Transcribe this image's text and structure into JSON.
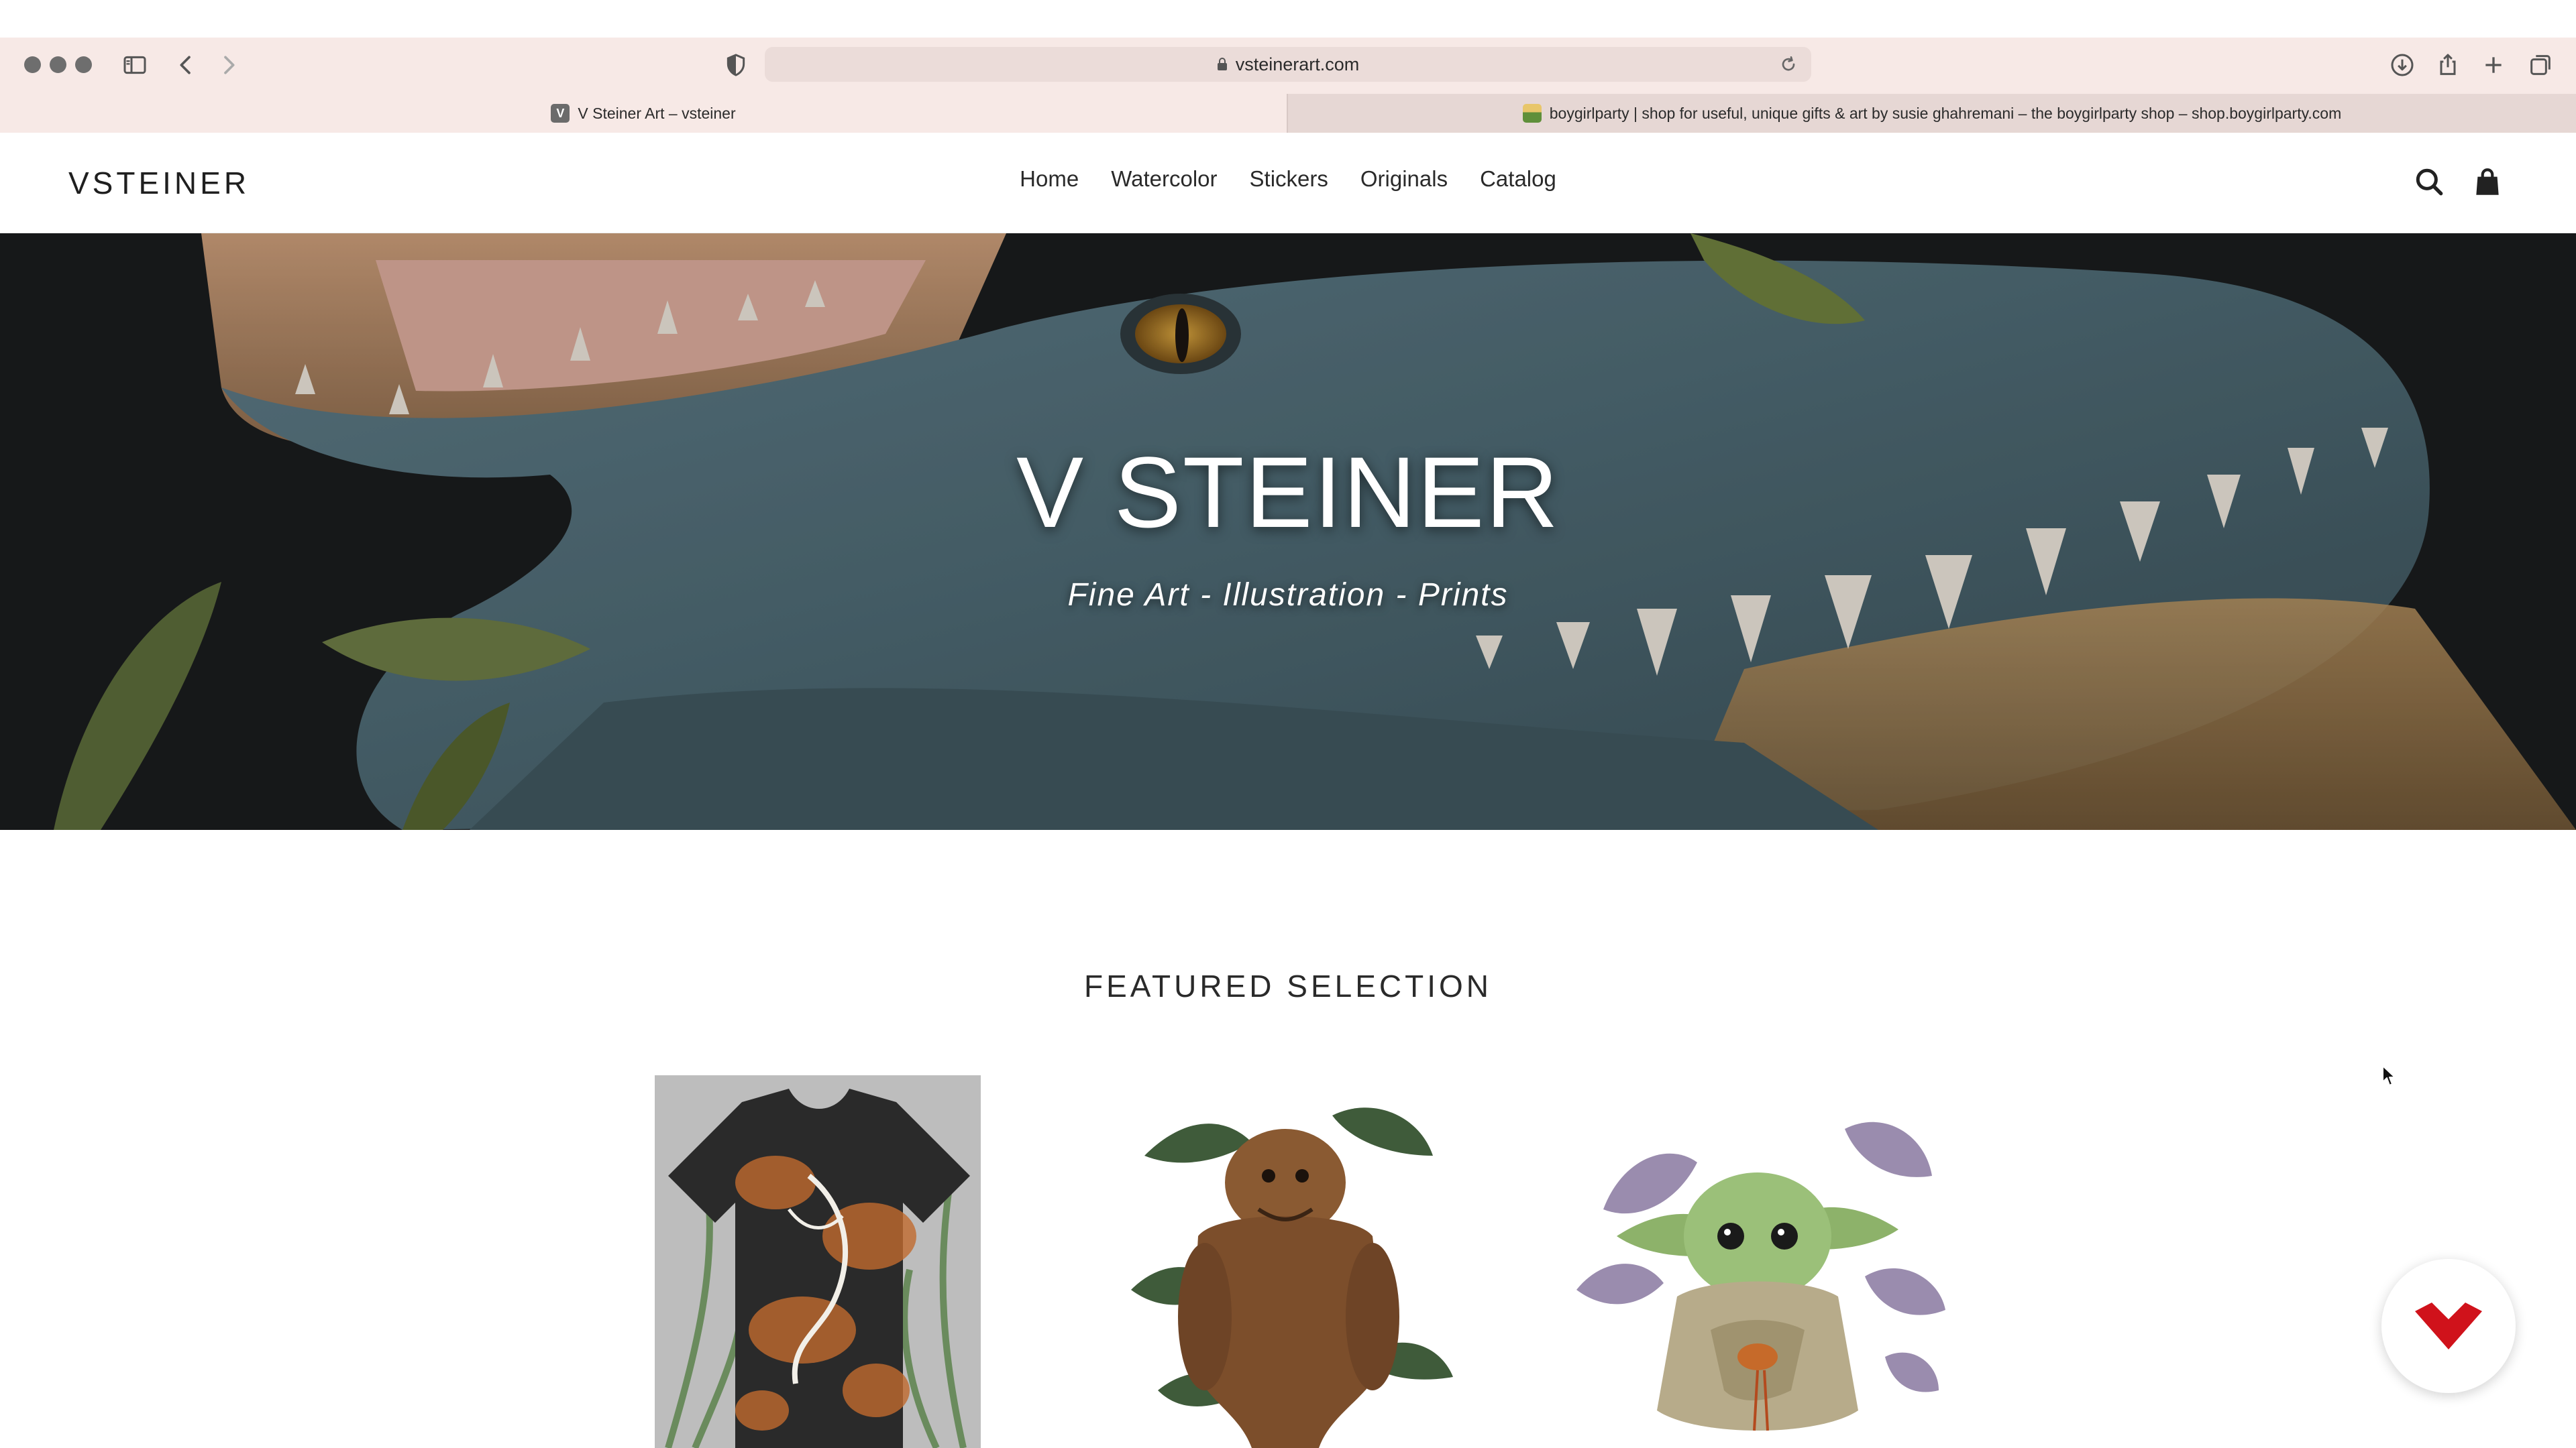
{
  "browser": {
    "url": "vsteinerart.com",
    "tabs": [
      {
        "title": "V Steiner Art – vsteiner",
        "favicon": "V"
      },
      {
        "title": "boygirlparty | shop for useful, unique gifts & art by susie ghahremani – the boygirlparty shop – shop.boygirlparty.com"
      }
    ],
    "icons": [
      "close-dot",
      "minimize-dot",
      "maximize-dot",
      "sidebar-icon",
      "back-icon",
      "forward-icon",
      "shield-icon",
      "lock-icon",
      "reload-icon",
      "download-icon",
      "share-icon",
      "new-tab-icon",
      "tabs-overview-icon"
    ]
  },
  "header": {
    "logo": "VSTEINER",
    "nav": [
      "Home",
      "Watercolor",
      "Stickers",
      "Originals",
      "Catalog"
    ],
    "icons": [
      "search-icon",
      "cart-icon"
    ]
  },
  "hero": {
    "title": "V STEINER",
    "subtitle": "Fine Art - Illustration - Prints"
  },
  "featured": {
    "heading": "FEATURED SELECTION",
    "products": [
      "tie-dye tiger t-shirt",
      "creature illustration print",
      "baby alien with frog print"
    ]
  },
  "colors": {
    "chrome": "#f7e9e6",
    "hero_overlay": "#17191a",
    "chat_accent": "#d0121b"
  }
}
